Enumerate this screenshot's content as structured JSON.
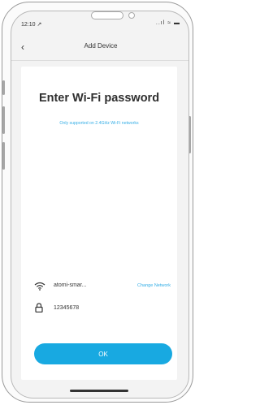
{
  "status_bar": {
    "time": "12:10 ↗",
    "icons": "..ıl ≈ ▬"
  },
  "nav": {
    "back_glyph": "‹",
    "title": "Add Device"
  },
  "main": {
    "heading": "Enter Wi-Fi password",
    "subtext": "Only supported on 2.4GHz Wi-Fi networks",
    "wifi": {
      "icon": "wifi-icon",
      "network_name": "atomi-smar...",
      "change_label": "Change Network"
    },
    "password": {
      "icon": "lock-icon",
      "value": "12345678"
    },
    "ok_label": "OK"
  },
  "colors": {
    "accent": "#18a9e1",
    "link": "#35aee6",
    "text": "#2f2f2f"
  }
}
